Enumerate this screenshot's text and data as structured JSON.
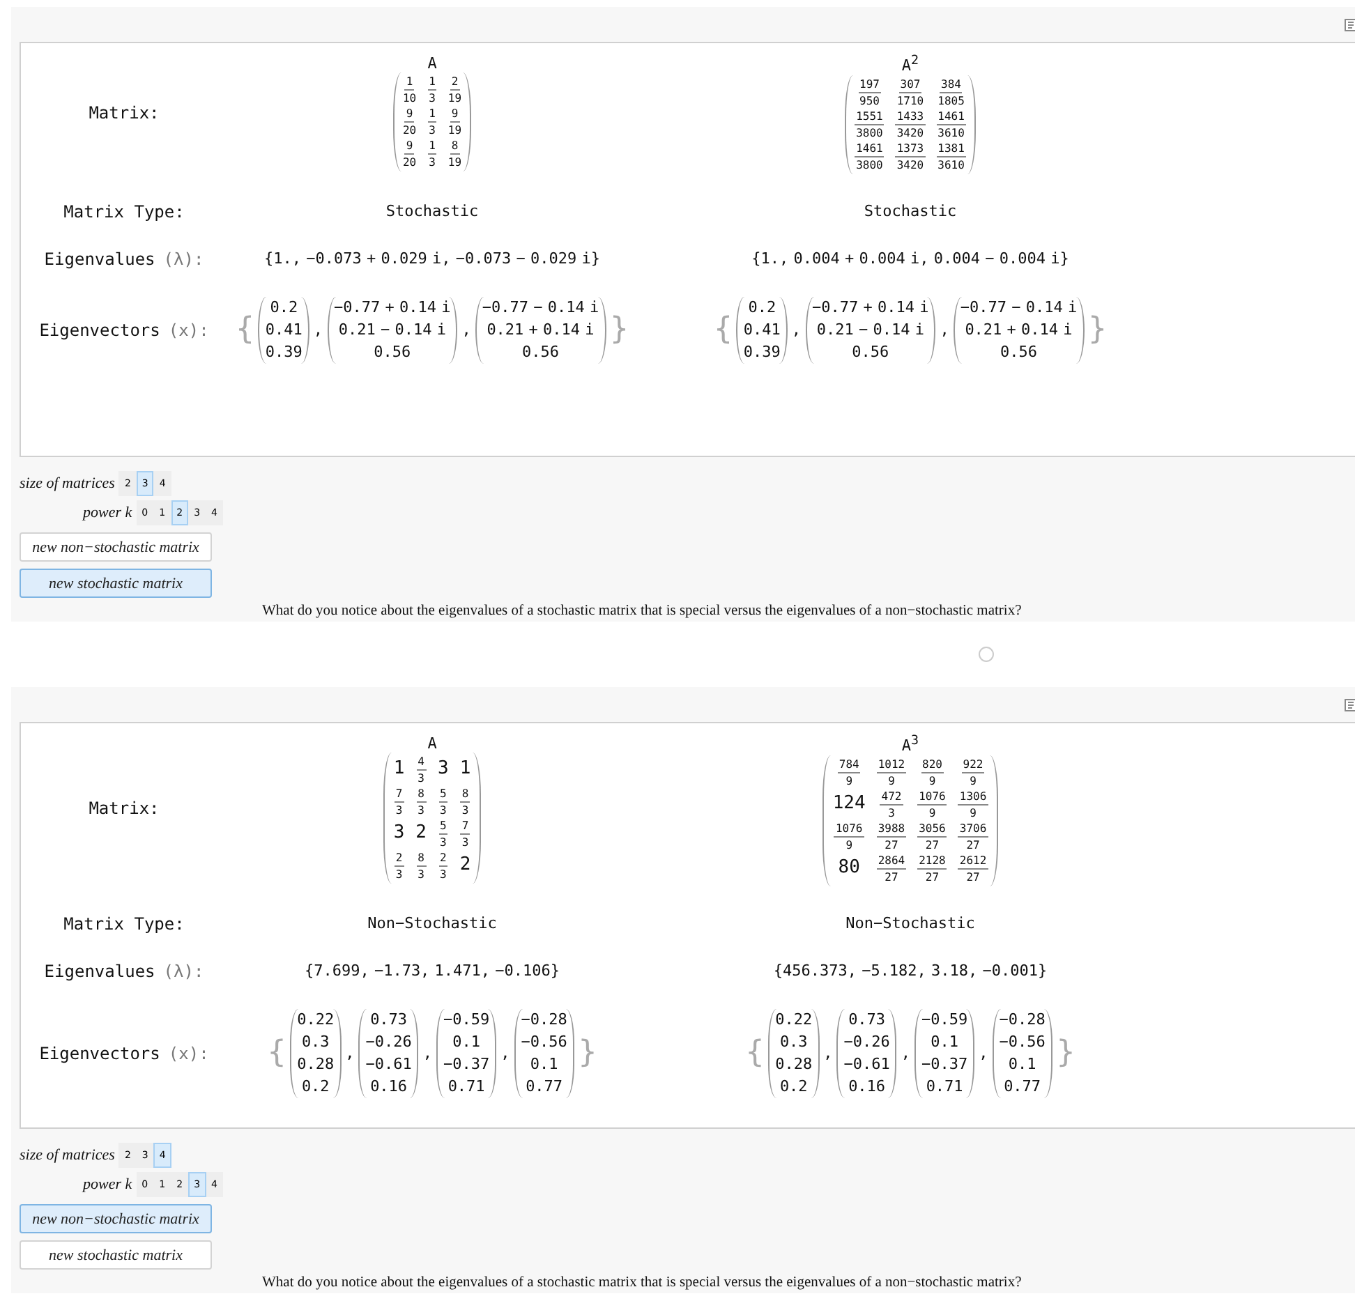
{
  "panels": [
    {
      "labels": {
        "matrix": "Matrix:",
        "type": "Matrix Type:",
        "eigenvalues": "Eigenvalues",
        "eigenvalues_symbol": "(λ):",
        "eigenvectors": "Eigenvectors",
        "eigenvectors_symbol": "(x):"
      },
      "columns": [
        {
          "title": "A",
          "matrix": [
            [
              {
                "kind": "fraction",
                "num": "1",
                "den": "10"
              },
              {
                "kind": "fraction",
                "num": "1",
                "den": "3"
              },
              {
                "kind": "fraction",
                "num": "2",
                "den": "19"
              }
            ],
            [
              {
                "kind": "fraction",
                "num": "9",
                "den": "20"
              },
              {
                "kind": "fraction",
                "num": "1",
                "den": "3"
              },
              {
                "kind": "fraction",
                "num": "9",
                "den": "19"
              }
            ],
            [
              {
                "kind": "fraction",
                "num": "9",
                "den": "20"
              },
              {
                "kind": "fraction",
                "num": "1",
                "den": "3"
              },
              {
                "kind": "fraction",
                "num": "8",
                "den": "19"
              }
            ]
          ],
          "matrix_type": "Stochastic",
          "eigenvalues": "{1., −0.073 + 0.029 i, −0.073 − 0.029 i}",
          "eigenvectors": {
            "open": "{",
            "close": "}",
            "separator": ",",
            "vectors": [
              [
                "0.2",
                "0.41",
                "0.39"
              ],
              [
                "−0.77 + 0.14 i",
                "0.21 − 0.14 i",
                "0.56"
              ],
              [
                "−0.77 − 0.14 i",
                "0.21 + 0.14 i",
                "0.56"
              ]
            ]
          }
        },
        {
          "title": "A$^{2}$",
          "matrix": [
            [
              {
                "kind": "fraction",
                "num": "197",
                "den": "950"
              },
              {
                "kind": "fraction",
                "num": "307",
                "den": "1710"
              },
              {
                "kind": "fraction",
                "num": "384",
                "den": "1805"
              }
            ],
            [
              {
                "kind": "fraction",
                "num": "1551",
                "den": "3800"
              },
              {
                "kind": "fraction",
                "num": "1433",
                "den": "3420"
              },
              {
                "kind": "fraction",
                "num": "1461",
                "den": "3610"
              }
            ],
            [
              {
                "kind": "fraction",
                "num": "1461",
                "den": "3800"
              },
              {
                "kind": "fraction",
                "num": "1373",
                "den": "3420"
              },
              {
                "kind": "fraction",
                "num": "1381",
                "den": "3610"
              }
            ]
          ],
          "matrix_type": "Stochastic",
          "eigenvalues": "{1., 0.004 + 0.004 i, 0.004 − 0.004 i}",
          "eigenvectors": {
            "open": "{",
            "close": "}",
            "separator": ",",
            "vectors": [
              [
                "0.2",
                "0.41",
                "0.39"
              ],
              [
                "−0.77 + 0.14 i",
                "0.21 − 0.14 i",
                "0.56"
              ],
              [
                "−0.77 − 0.14 i",
                "0.21 + 0.14 i",
                "0.56"
              ]
            ]
          }
        }
      ],
      "controls": {
        "size": {
          "label": "size of matrices",
          "options": [
            {
              "label": "2",
              "selected": false
            },
            {
              "label": "3",
              "selected": true
            },
            {
              "label": "4",
              "selected": false
            }
          ]
        },
        "power": {
          "label": "power k",
          "options": [
            {
              "label": "0",
              "selected": false
            },
            {
              "label": "1",
              "selected": false
            },
            {
              "label": "2",
              "selected": true
            },
            {
              "label": "3",
              "selected": false
            },
            {
              "label": "4",
              "selected": false
            }
          ]
        },
        "buttons": [
          {
            "label": "new non−stochastic matrix",
            "selected": false
          },
          {
            "label": "new stochastic matrix",
            "selected": true
          }
        ]
      },
      "question": "What do you notice about the eigenvalues of a stochastic matrix that is special versus the eigenvalues of a non−stochastic matrix?"
    },
    {
      "labels": {
        "matrix": "Matrix:",
        "type": "Matrix Type:",
        "eigenvalues": "Eigenvalues",
        "eigenvalues_symbol": "(λ):",
        "eigenvectors": "Eigenvectors",
        "eigenvectors_symbol": "(x):"
      },
      "columns": [
        {
          "title": "A",
          "matrix": [
            [
              {
                "kind": "integer",
                "text": "1"
              },
              {
                "kind": "fraction",
                "num": "4",
                "den": "3"
              },
              {
                "kind": "integer",
                "text": "3"
              },
              {
                "kind": "integer",
                "text": "1"
              }
            ],
            [
              {
                "kind": "fraction",
                "num": "7",
                "den": "3"
              },
              {
                "kind": "fraction",
                "num": "8",
                "den": "3"
              },
              {
                "kind": "fraction",
                "num": "5",
                "den": "3"
              },
              {
                "kind": "fraction",
                "num": "8",
                "den": "3"
              }
            ],
            [
              {
                "kind": "integer",
                "text": "3"
              },
              {
                "kind": "integer",
                "text": "2"
              },
              {
                "kind": "fraction",
                "num": "5",
                "den": "3"
              },
              {
                "kind": "fraction",
                "num": "7",
                "den": "3"
              }
            ],
            [
              {
                "kind": "fraction",
                "num": "2",
                "den": "3"
              },
              {
                "kind": "fraction",
                "num": "8",
                "den": "3"
              },
              {
                "kind": "fraction",
                "num": "2",
                "den": "3"
              },
              {
                "kind": "integer",
                "text": "2"
              }
            ]
          ],
          "matrix_type": "Non−Stochastic",
          "eigenvalues": "{7.699, −1.73, 1.471, −0.106}",
          "eigenvectors": {
            "open": "{",
            "close": "}",
            "separator": ",",
            "vectors": [
              [
                "0.22",
                "0.3",
                "0.28",
                "0.2"
              ],
              [
                "0.73",
                "−0.26",
                "−0.61",
                "0.16"
              ],
              [
                "−0.59",
                "0.1",
                "−0.37",
                "0.71"
              ],
              [
                "−0.28",
                "−0.56",
                "0.1",
                "0.77"
              ]
            ]
          }
        },
        {
          "title": "A$^{3}$",
          "matrix": [
            [
              {
                "kind": "fraction",
                "num": "784",
                "den": "9"
              },
              {
                "kind": "fraction",
                "num": "1012",
                "den": "9"
              },
              {
                "kind": "fraction",
                "num": "820",
                "den": "9"
              },
              {
                "kind": "fraction",
                "num": "922",
                "den": "9"
              }
            ],
            [
              {
                "kind": "integer",
                "text": "124"
              },
              {
                "kind": "fraction",
                "num": "472",
                "den": "3"
              },
              {
                "kind": "fraction",
                "num": "1076",
                "den": "9"
              },
              {
                "kind": "fraction",
                "num": "1306",
                "den": "9"
              }
            ],
            [
              {
                "kind": "fraction",
                "num": "1076",
                "den": "9"
              },
              {
                "kind": "fraction",
                "num": "3988",
                "den": "27"
              },
              {
                "kind": "fraction",
                "num": "3056",
                "den": "27"
              },
              {
                "kind": "fraction",
                "num": "3706",
                "den": "27"
              }
            ],
            [
              {
                "kind": "integer",
                "text": "80"
              },
              {
                "kind": "fraction",
                "num": "2864",
                "den": "27"
              },
              {
                "kind": "fraction",
                "num": "2128",
                "den": "27"
              },
              {
                "kind": "fraction",
                "num": "2612",
                "den": "27"
              }
            ]
          ],
          "matrix_type": "Non−Stochastic",
          "eigenvalues": "{456.373, −5.182, 3.18, −0.001}",
          "eigenvectors": {
            "open": "{",
            "close": "}",
            "separator": ",",
            "vectors": [
              [
                "0.22",
                "0.3",
                "0.28",
                "0.2"
              ],
              [
                "0.73",
                "−0.26",
                "−0.61",
                "0.16"
              ],
              [
                "−0.59",
                "0.1",
                "−0.37",
                "0.71"
              ],
              [
                "−0.28",
                "−0.56",
                "0.1",
                "0.77"
              ]
            ]
          }
        }
      ],
      "controls": {
        "size": {
          "label": "size of matrices",
          "options": [
            {
              "label": "2",
              "selected": false
            },
            {
              "label": "3",
              "selected": false
            },
            {
              "label": "4",
              "selected": true
            }
          ]
        },
        "power": {
          "label": "power k",
          "options": [
            {
              "label": "0",
              "selected": false
            },
            {
              "label": "1",
              "selected": false
            },
            {
              "label": "2",
              "selected": false
            },
            {
              "label": "3",
              "selected": true
            },
            {
              "label": "4",
              "selected": false
            }
          ]
        },
        "buttons": [
          {
            "label": "new non−stochastic matrix",
            "selected": true
          },
          {
            "label": "new stochastic matrix",
            "selected": false
          }
        ]
      },
      "question": "What do you notice about the eigenvalues of a stochastic matrix that is special versus the eigenvalues of a non−stochastic matrix?"
    }
  ]
}
